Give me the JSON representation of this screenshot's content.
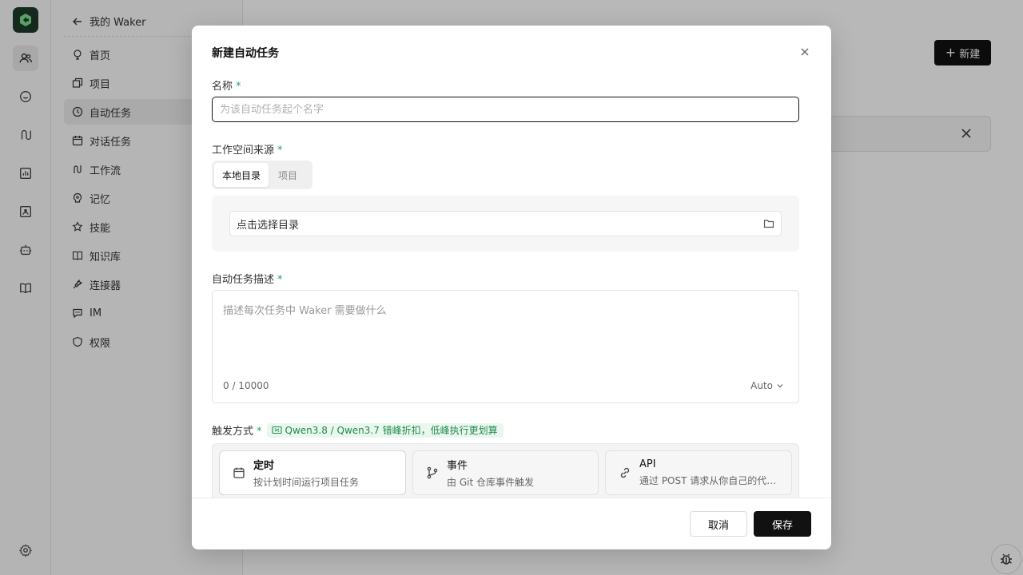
{
  "app": {
    "back_label": "我的 Waker",
    "sidebar": [
      {
        "label": "首页",
        "icon": "home-icon"
      },
      {
        "label": "项目",
        "icon": "projects-icon"
      },
      {
        "label": "自动任务",
        "icon": "clock-icon",
        "active": true
      },
      {
        "label": "对话任务",
        "icon": "calendar-icon"
      },
      {
        "label": "工作流",
        "icon": "workflow-icon"
      },
      {
        "label": "记忆",
        "icon": "memory-icon"
      },
      {
        "label": "技能",
        "icon": "skill-icon"
      },
      {
        "label": "知识库",
        "icon": "book-icon"
      },
      {
        "label": "连接器",
        "icon": "plug-icon"
      },
      {
        "label": "IM",
        "icon": "chat-icon"
      },
      {
        "label": "权限",
        "icon": "shield-icon"
      }
    ],
    "new_button_label": "新建",
    "brand_color": "#1f3a2a"
  },
  "modal": {
    "title": "新建自动任务",
    "name": {
      "label": "名称",
      "required_mark": "*",
      "placeholder": "为该自动任务起个名字",
      "value": ""
    },
    "workspace": {
      "label": "工作空间来源",
      "required_mark": "*",
      "options": [
        "本地目录",
        "项目"
      ],
      "selected": "本地目录",
      "directory_placeholder": "点击选择目录"
    },
    "description": {
      "label": "自动任务描述",
      "required_mark": "*",
      "placeholder": "描述每次任务中 Waker 需要做什么",
      "counter": "0 / 10000",
      "model_selector": "Auto"
    },
    "trigger": {
      "label": "触发方式",
      "required_mark": "*",
      "promo": "Qwen3.8 / Qwen3.7 错峰折扣，低峰执行更划算",
      "options": [
        {
          "title": "定时",
          "subtitle": "按计划时间运行项目任务",
          "icon": "calendar-icon",
          "selected": true
        },
        {
          "title": "事件",
          "subtitle": "由 Git 仓库事件触发",
          "icon": "git-branch-icon",
          "selected": false
        },
        {
          "title": "API",
          "subtitle": "通过 POST 请求从你自己的代码中触发",
          "icon": "link-icon",
          "selected": false
        }
      ]
    },
    "footer": {
      "cancel_label": "取消",
      "save_label": "保存"
    }
  }
}
